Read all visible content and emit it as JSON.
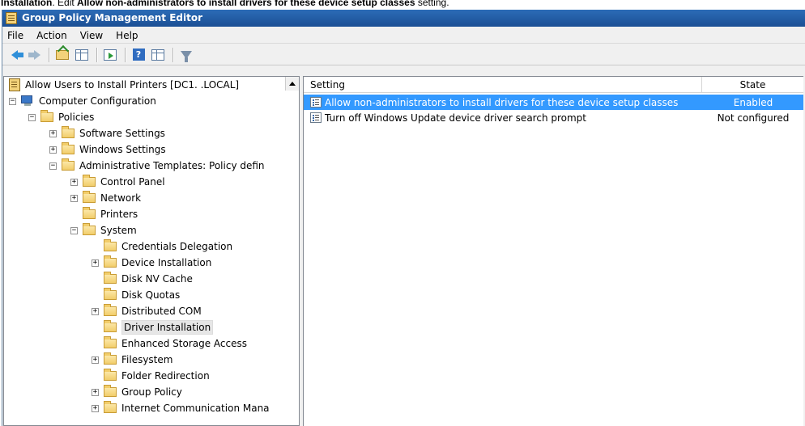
{
  "caption": {
    "prefix": "Installation",
    "middle": ". Edit ",
    "bold": "Allow non-administrators to install drivers for these device setup classes",
    "suffix": " setting."
  },
  "window": {
    "title": "Group Policy Management Editor"
  },
  "menu": [
    "File",
    "Action",
    "View",
    "Help"
  ],
  "toolbar": {
    "icons": [
      "back-icon",
      "forward-icon",
      "up-folder-icon",
      "show-hide-tree-icon",
      "export-list-icon",
      "help-icon",
      "properties-icon",
      "filter-icon"
    ]
  },
  "tree": {
    "root": "Allow Users to Install Printers [DC1.          .LOCAL]",
    "items": [
      {
        "label": "Computer Configuration",
        "expander": "−"
      },
      {
        "label": "Policies",
        "expander": "−"
      },
      {
        "label": "Software Settings",
        "expander": "+"
      },
      {
        "label": "Windows Settings",
        "expander": "+"
      },
      {
        "label": "Administrative Templates: Policy defin",
        "expander": "−"
      },
      {
        "label": "Control Panel",
        "expander": "+"
      },
      {
        "label": "Network",
        "expander": "+"
      },
      {
        "label": "Printers",
        "expander": ""
      },
      {
        "label": "System",
        "expander": "−"
      },
      {
        "label": "Credentials Delegation",
        "expander": ""
      },
      {
        "label": "Device Installation",
        "expander": "+"
      },
      {
        "label": "Disk NV Cache",
        "expander": ""
      },
      {
        "label": "Disk Quotas",
        "expander": ""
      },
      {
        "label": "Distributed COM",
        "expander": "+"
      },
      {
        "label": "Driver Installation",
        "expander": ""
      },
      {
        "label": "Enhanced Storage Access",
        "expander": ""
      },
      {
        "label": "Filesystem",
        "expander": "+"
      },
      {
        "label": "Folder Redirection",
        "expander": ""
      },
      {
        "label": "Group Policy",
        "expander": "+"
      },
      {
        "label": "Internet Communication Mana",
        "expander": "+"
      }
    ]
  },
  "list": {
    "columns": [
      "Setting",
      "State"
    ],
    "rows": [
      {
        "setting": "Allow non-administrators to install drivers for these device setup classes",
        "state": "Enabled"
      },
      {
        "setting": "Turn off Windows Update device driver search prompt",
        "state": "Not configured"
      }
    ]
  },
  "colors": {
    "selection": "#3399ff",
    "titlebar": "#1b4f94"
  }
}
